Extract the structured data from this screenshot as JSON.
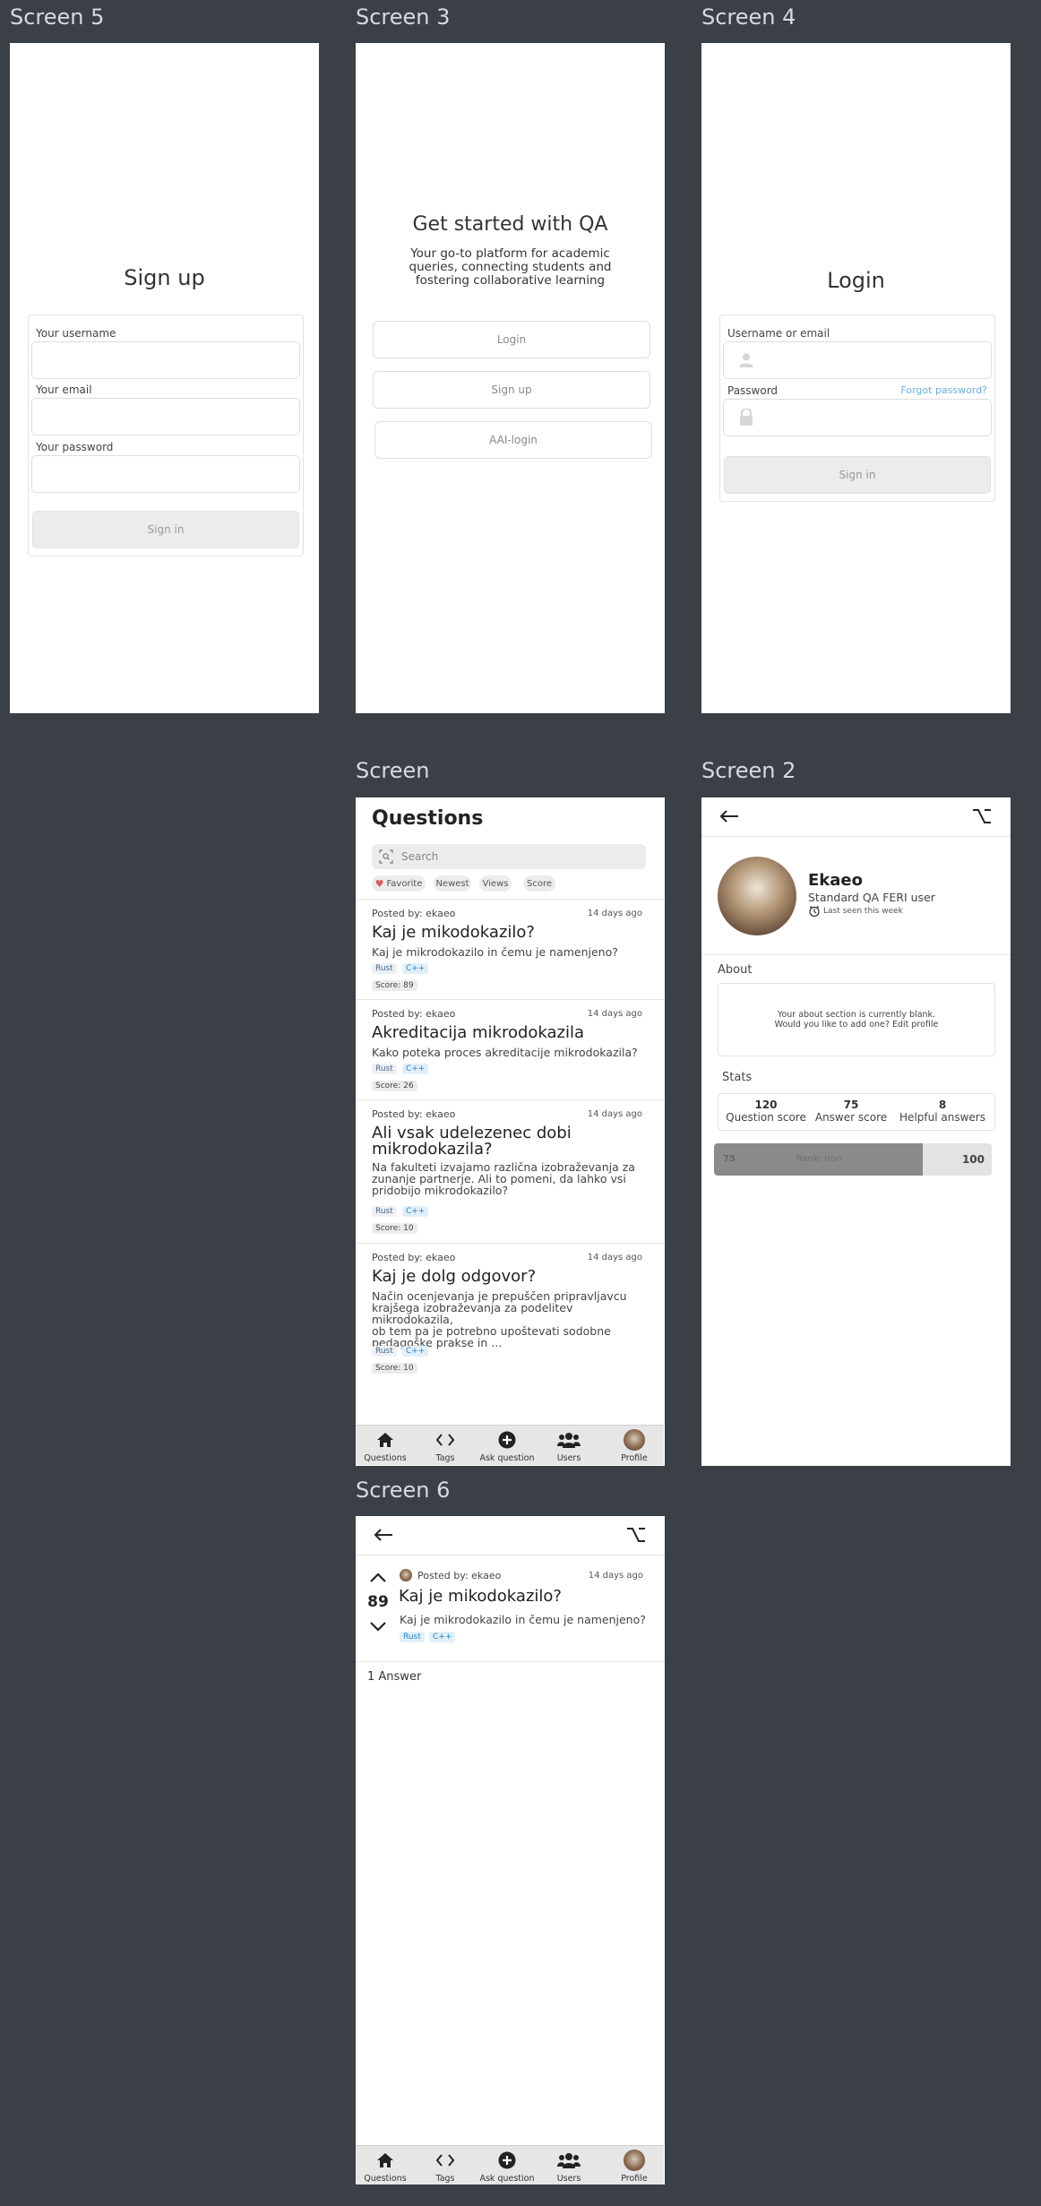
{
  "screens": {
    "screen5": "Screen 5",
    "screen3": "Screen 3",
    "screen4": "Screen 4",
    "screen_main": "Screen",
    "screen2": "Screen 2",
    "screen6": "Screen 6"
  },
  "signup": {
    "title": "Sign up",
    "username_label": "Your username",
    "email_label": "Your email",
    "password_label": "Your password",
    "submit": "Sign in"
  },
  "welcome": {
    "title": "Get started with QA",
    "subtitle_1": "Your go-to platform for academic",
    "subtitle_2": "queries, connecting students and",
    "subtitle_3": "fostering collaborative learning",
    "login": "Login",
    "signup": "Sign up",
    "aai": "AAI-login"
  },
  "login": {
    "title": "Login",
    "user_label": "Username or email",
    "password_label": "Password",
    "forgot": "Forgot password?",
    "submit": "Sign in"
  },
  "questions": {
    "title": "Questions",
    "search_placeholder": "Search",
    "filters": [
      "Favorite",
      "Newest",
      "Views",
      "Score"
    ],
    "items": [
      {
        "posted": "Posted by: ekaeo",
        "ago": "14 days ago",
        "title": "Kaj je mikodokazilo?",
        "body": "Kaj je mikrodokazilo in čemu je namenjeno?",
        "tags": [
          "Rust",
          "C++"
        ],
        "score": "Score: 89"
      },
      {
        "posted": "Posted by: ekaeo",
        "ago": "14 days ago",
        "title": "Akreditacija mikrodokazila",
        "body": "Kako poteka proces akreditacije mikrodokazila?",
        "tags": [
          "Rust",
          "C++"
        ],
        "score": "Score: 26"
      },
      {
        "posted": "Posted by: ekaeo",
        "ago": "14 days ago",
        "title_1": "Ali vsak udelezenec dobi",
        "title_2": "mikrodokazila?",
        "body_1": "Na fakulteti izvajamo različna izobraževanja za",
        "body_2": "zunanje partnerje. Ali to pomeni, da lahko vsi",
        "body_3": "pridobijo mikrodokazilo?",
        "tags": [
          "Rust",
          "C++"
        ],
        "score": "Score: 10"
      },
      {
        "posted": "Posted by: ekaeo",
        "ago": "14 days ago",
        "title": "Kaj je dolg odgovor?",
        "body_1": "Način ocenjevanja je prepuščen pripravljavcu",
        "body_2": "krajšega izobraževanja za podelitev mikrodokazila,",
        "body_3": "ob tem pa je potrebno upoštevati sodobne",
        "body_4": "pedagoške prakse in ...",
        "tags": [
          "Rust",
          "C++"
        ],
        "score": "Score: 10"
      }
    ]
  },
  "nav": {
    "questions": "Questions",
    "tags": "Tags",
    "ask": "Ask question",
    "users": "Users",
    "profile": "Profile"
  },
  "profile": {
    "name": "Ekaeo",
    "role": "Standard QA FERI user",
    "last_seen": "Last seen this week",
    "about_label": "About",
    "about_text_1": "Your about section is currently blank.",
    "about_text_2": "Would you like to add one? Edit profile",
    "stats_label": "Stats",
    "stats": [
      {
        "value": "120",
        "label": "Question score"
      },
      {
        "value": "75",
        "label": "Answer score"
      },
      {
        "value": "8",
        "label": "Helpful answers"
      }
    ],
    "rank_current": "75",
    "rank_label": "Rank: Iron",
    "rank_max": "100",
    "rank_progress": 0.75
  },
  "question_detail": {
    "votes": "89",
    "posted": "Posted by: ekaeo",
    "ago": "14 days ago",
    "title": "Kaj je mikodokazilo?",
    "body": "Kaj je mikrodokazilo in čemu je namenjeno?",
    "tags": [
      "Rust",
      "C++"
    ],
    "answers": "1 Answer"
  },
  "colors": {
    "background": "#3b3f46",
    "link": "#6aaee8",
    "heart": "#e05a5a"
  }
}
